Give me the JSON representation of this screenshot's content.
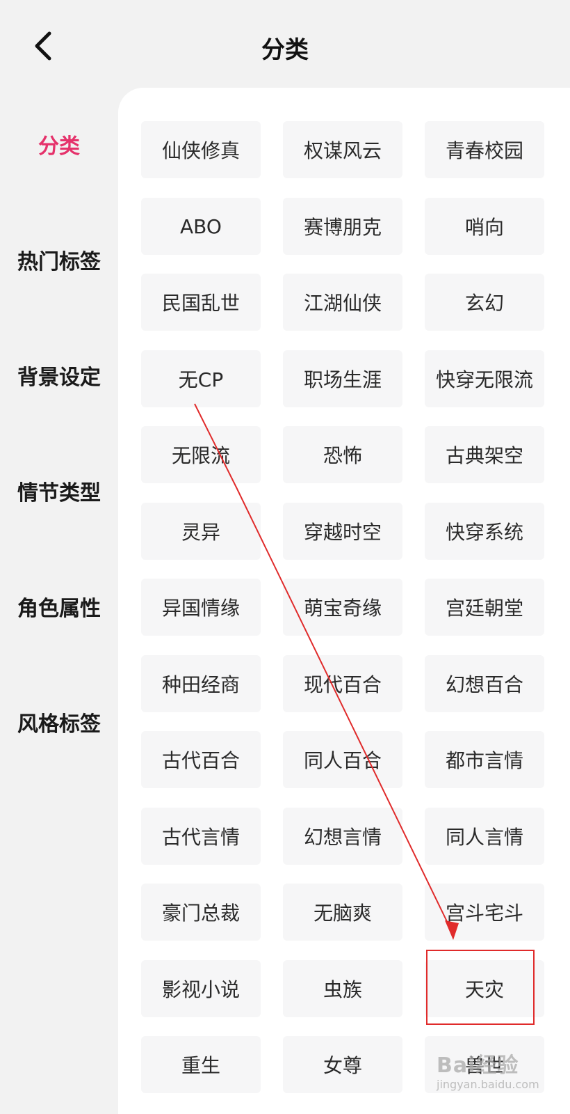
{
  "header": {
    "title": "分类"
  },
  "sidebar": {
    "items": [
      {
        "label": "分类",
        "active": true
      },
      {
        "label": "热门标签",
        "active": false
      },
      {
        "label": "背景设定",
        "active": false
      },
      {
        "label": "情节类型",
        "active": false
      },
      {
        "label": "角色属性",
        "active": false
      },
      {
        "label": "风格标签",
        "active": false
      }
    ]
  },
  "tags": [
    "仙侠修真",
    "权谋风云",
    "青春校园",
    "ABO",
    "赛博朋克",
    "哨向",
    "民国乱世",
    "江湖仙侠",
    "玄幻",
    "无CP",
    "职场生涯",
    "快穿无限流",
    "无限流",
    "恐怖",
    "古典架空",
    "灵异",
    "穿越时空",
    "快穿系统",
    "异国情缘",
    "萌宝奇缘",
    "宫廷朝堂",
    "种田经商",
    "现代百合",
    "幻想百合",
    "古代百合",
    "同人百合",
    "都市言情",
    "古代言情",
    "幻想言情",
    "同人言情",
    "豪门总裁",
    "无脑爽",
    "宫斗宅斗",
    "影视小说",
    "虫族",
    "天灾",
    "重生",
    "女尊",
    "兽世"
  ],
  "annotation": {
    "color": "#e02b2b",
    "highlighted_tag": "天灾"
  },
  "watermark": {
    "main": "Bai经验",
    "sub": "jingyan.baidu.com"
  },
  "colors": {
    "accent": "#e5326b",
    "tag_bg": "#f6f6f7",
    "page_bg": "#f2f2f2"
  }
}
